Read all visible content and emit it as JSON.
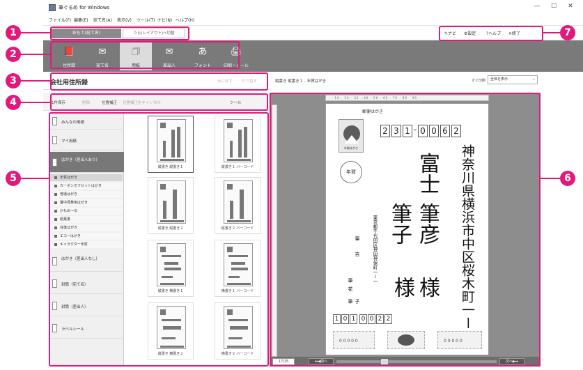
{
  "window": {
    "title": "筆ぐるめ for Windows",
    "controls": {
      "minimize": "—",
      "maximize": "☐",
      "close": "✕"
    }
  },
  "menu": [
    "ファイル(F)",
    "編集(E)",
    "宛て名(A)",
    "表示(V)",
    "ツール(T)",
    "ナビ(N)",
    "ヘルプ(H)"
  ],
  "mode": {
    "omote": "おもて(宛て名)",
    "ura": "うら(レイアウト)へ切替"
  },
  "top_right": {
    "navi": "ナビ",
    "settings": "設定",
    "help": "ヘルプ",
    "exit": "終了"
  },
  "ribbon": [
    {
      "label": "住所録",
      "icon": "address-book-icon",
      "glyph": "📕"
    },
    {
      "label": "宛て名",
      "icon": "recipient-icon",
      "glyph": "✉"
    },
    {
      "label": "用紙",
      "icon": "paper-icon",
      "glyph": "🗇",
      "active": true
    },
    {
      "label": "差出人",
      "icon": "sender-icon",
      "glyph": "✉"
    },
    {
      "label": "フォント",
      "icon": "font-icon",
      "glyph": "あ"
    },
    {
      "label": "印刷・メール",
      "icon": "print-mail-icon",
      "glyph": "🖨"
    }
  ],
  "left_header": {
    "title": "会社用住所録",
    "undo": "元に戻す",
    "redo": "やり直す"
  },
  "left_toolbar": {
    "save": "1件保存",
    "delete": "削除",
    "position": "位置補正",
    "cancel_position": "位置補正をキャンセル",
    "tools": "ツール"
  },
  "categories": [
    {
      "label": "みんなの用紙"
    },
    {
      "label": "マイ用紙"
    },
    {
      "label": "はがき（差出人あり）",
      "active": true
    },
    {
      "label": "はがき（差出人なし）"
    },
    {
      "label": "封筒（宛て名）"
    },
    {
      "label": "封筒（差出人）"
    },
    {
      "label": "ラベルシール"
    }
  ],
  "subcategories": [
    {
      "label": "年賀はがき",
      "selected": true
    },
    {
      "label": "カーボンオフセットはがき"
    },
    {
      "label": "普通はがき"
    },
    {
      "label": "暑中見舞用はがき"
    },
    {
      "label": "かもめ〜る"
    },
    {
      "label": "絵葉書"
    },
    {
      "label": "往復はがき"
    },
    {
      "label": "エコーはがき"
    },
    {
      "label": "キャラクター年賀"
    }
  ],
  "thumbnails": [
    {
      "label": "縦書き 縦書き１"
    },
    {
      "label": "縦書き１ バーコード"
    },
    {
      "label": "縦書き 縦書き２"
    },
    {
      "label": "縦書き２ バーコード"
    },
    {
      "label": "縦書き 横書き１"
    },
    {
      "label": "横書き１ バーコード"
    },
    {
      "label": "縦書き 横書き２"
    },
    {
      "label": "横書き２ バーコード"
    }
  ],
  "preview": {
    "caption": "縦書き 縦書き１ - 年賀はがき",
    "zoom_label": "すぐ印刷",
    "zoom_value": "全体を表示",
    "ruler": "· 10 · 20 · 30 · 40 · 50 · 60 · 70 · 80 · 90 ·"
  },
  "postcard": {
    "header": "郵便はがき",
    "stamp_caption": "年賀はがき",
    "postmark": "年賀",
    "zip": [
      "2",
      "3",
      "1",
      "0",
      "0",
      "6",
      "2"
    ],
    "address": "神奈川県横浜市中区桜木町一ー一",
    "name_line1": "富士",
    "name_line2": "筆彦",
    "company": "筆子",
    "honorific1": "様",
    "honorific2": "様",
    "sender_address": "東京都千代田区神田神保町一ー一",
    "sender_name1": "筆",
    "sender_name2": "吉",
    "sender_name3": "筆",
    "sender_name4": "花",
    "sender_name5": "筆",
    "sender_name6": "子",
    "sender_zip": [
      "1",
      "0",
      "1",
      "0",
      "0",
      "2",
      "2"
    ],
    "bottom_code": "0 0 0 0 0"
  },
  "pager": {
    "count": "17/25",
    "prev": "前へ",
    "next": "次へ"
  },
  "callouts": [
    "1",
    "2",
    "3",
    "4",
    "5",
    "6",
    "7"
  ],
  "accent_color": "#e2197b"
}
